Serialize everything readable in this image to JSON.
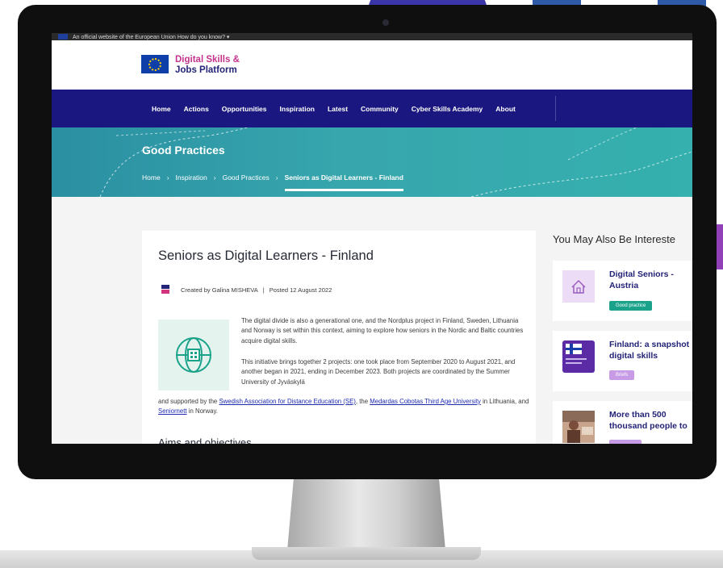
{
  "banner": {
    "text": "An official website of the European Union   How do you know?  ▾"
  },
  "logo": {
    "line1": "Digital Skills &",
    "line2": "Jobs Platform"
  },
  "nav": {
    "items": [
      "Home",
      "Actions",
      "Opportunities",
      "Inspiration",
      "Latest",
      "Community",
      "Cyber Skills Academy",
      "About"
    ]
  },
  "hero": {
    "title": "Good Practices",
    "breadcrumb": [
      "Home",
      "Inspiration",
      "Good Practices",
      "Seniors as Digital Learners - Finland"
    ],
    "separator": "›"
  },
  "article": {
    "title": "Seniors as Digital Learners - Finland",
    "author": "Created by Galina MISHEVA",
    "date": "Posted 12 August 2022",
    "p1": "The digital divide is also a generational one, and the Nordplus project in Finland, Sweden, Lithuania and Norway is set within this context, aiming to explore how seniors in the Nordic and Baltic countries acquire digital skills.",
    "p2": "This initiative brings together 2 projects: one took place from September 2020 to August 2021, and another began in 2021, ending in December 2023. Both projects are coordinated by the Summer University of Jyväskylä",
    "p3_before": "and supported by the ",
    "link1": "Swedish Association for Distance Education (SE)",
    "p3_mid1": ", the ",
    "link2": "Medardas Cobotas Third Age University",
    "p3_mid2": " in Lithuania, and ",
    "link3": "Seniornett",
    "p3_after": " in Norway.",
    "next_heading": "Aims and objectives"
  },
  "sidebar": {
    "title": "You May Also Be Intereste",
    "cards": [
      {
        "line1": "Digital Seniors -",
        "line2": "Austria",
        "badge": "Good practice"
      },
      {
        "line1": "Finland: a snapshot",
        "line2": "digital skills",
        "badge": "Briefs"
      },
      {
        "line1": "More than 500",
        "line2": "thousand people to",
        "badge": ""
      }
    ]
  },
  "colors": {
    "nav_bg": "#1a1880",
    "hero_teal": "#37a6ad",
    "brand_pink": "#c4328c",
    "brand_navy": "#232378",
    "badge_green": "#1aa38a",
    "badge_lilac": "#c79be6"
  }
}
